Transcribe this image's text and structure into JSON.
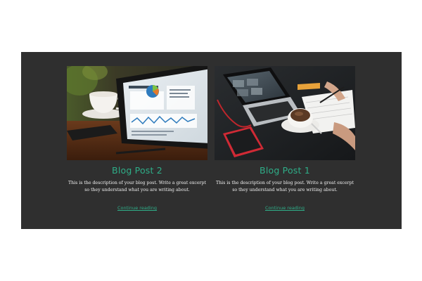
{
  "posts": [
    {
      "image": "tablet-analytics-coffee-image",
      "title": "Blog Post 2",
      "description": "This is the description of your blog post. Write a great excerpt so they understand what you are writing about.",
      "link_text": "Continue reading"
    },
    {
      "image": "laptop-coffee-notebook-image",
      "title": "Blog Post 1",
      "description": "This is the description of your blog post. Write a great excerpt so they understand what you are writing about.",
      "link_text": "Continue reading"
    }
  ],
  "colors": {
    "panel_background": "#2f2f2f",
    "accent": "#2fae88",
    "text": "#f1f1f1"
  }
}
